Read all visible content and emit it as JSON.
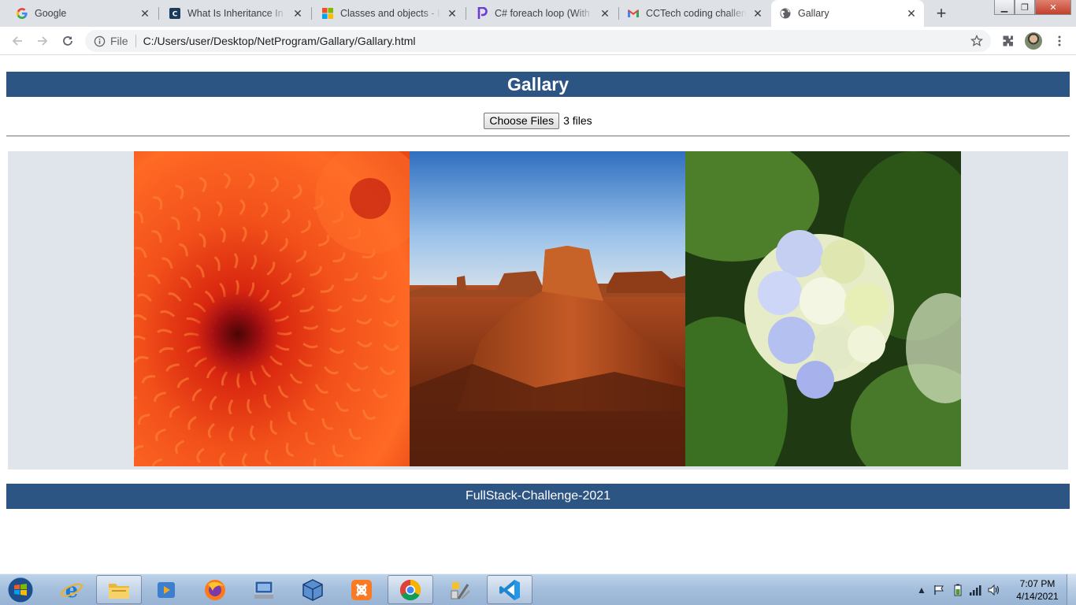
{
  "browser": {
    "tabs": [
      {
        "title": "Google",
        "icon": "google-icon",
        "active": false
      },
      {
        "title": "What Is Inheritance In C#",
        "icon": "csharpcorner-icon",
        "active": false
      },
      {
        "title": "Classes and objects - Introduction",
        "icon": "microsoft-icon",
        "active": false
      },
      {
        "title": "C# foreach loop (With Examples)",
        "icon": "programiz-icon",
        "active": false
      },
      {
        "title": "CCTech coding challenge",
        "icon": "gmail-icon",
        "active": false
      },
      {
        "title": "Gallary",
        "icon": "globe-icon",
        "active": true
      }
    ],
    "address": {
      "scheme_label": "File",
      "url": "C:/Users/user/Desktop/NetProgram/Gallary/Gallary.html"
    }
  },
  "page": {
    "header_title": "Gallary",
    "file_input": {
      "button_label": "Choose Files",
      "status": "3 files"
    },
    "gallery": [
      {
        "name": "chrysanthemum-photo"
      },
      {
        "name": "desert-photo"
      },
      {
        "name": "hydrangeas-photo"
      }
    ],
    "footer_text": "FullStack-Challenge-2021"
  },
  "taskbar": {
    "pinned": [
      "internet-explorer-icon",
      "file-explorer-icon",
      "media-player-icon",
      "firefox-icon",
      "remote-desktop-icon",
      "virtualbox-icon",
      "xampp-icon",
      "chrome-icon",
      "tools-icon",
      "vscode-icon"
    ],
    "clock_time": "7:07 PM",
    "clock_date": "4/14/2021"
  },
  "colors": {
    "header_bg": "#2d5583",
    "gallery_bg": "#e0e5ec",
    "tabstrip_bg": "#dee1e6"
  }
}
